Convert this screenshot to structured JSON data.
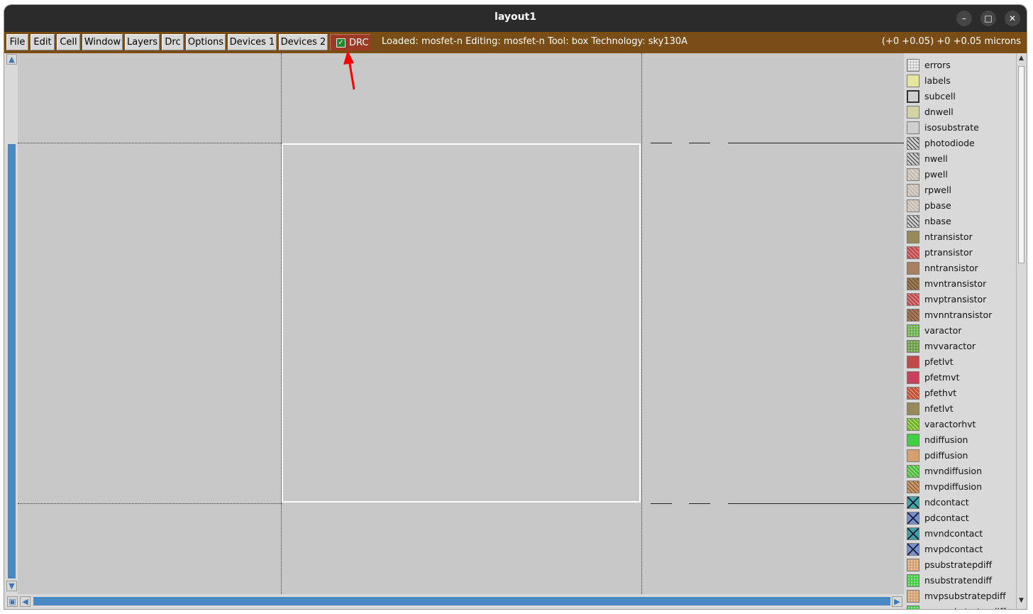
{
  "window": {
    "title": "layout1",
    "minimize_label": "–",
    "maximize_label": "□",
    "close_label": "✕"
  },
  "menu": {
    "items": [
      {
        "label": "File"
      },
      {
        "label": "Edit"
      },
      {
        "label": "Cell"
      },
      {
        "label": "Window"
      },
      {
        "label": "Layers"
      },
      {
        "label": "Drc"
      },
      {
        "label": "Options"
      },
      {
        "label": "Devices 1"
      },
      {
        "label": "Devices 2"
      }
    ],
    "drc_toggle": {
      "label": "DRC",
      "checked": true
    }
  },
  "status": {
    "text": "Loaded: mosfet-n Editing: mosfet-n Tool: box  Technology: sky130A",
    "coords": "(+0 +0.05) +0 +0.05 microns"
  },
  "layers": [
    {
      "name": "errors",
      "color": "#e8e8e8",
      "pattern": "grid"
    },
    {
      "name": "labels",
      "color": "#e6e6a0",
      "pattern": "solid"
    },
    {
      "name": "subcell",
      "color": "#d0d0d0",
      "pattern": "outline"
    },
    {
      "name": "dnwell",
      "color": "#d6d2a8",
      "pattern": "solid"
    },
    {
      "name": "isosubstrate",
      "color": "#cfcfcf",
      "pattern": "solid"
    },
    {
      "name": "photodiode",
      "color": "#d0d0d0",
      "pattern": "hatch"
    },
    {
      "name": "nwell",
      "color": "#d0d0d0",
      "pattern": "hatch"
    },
    {
      "name": "pwell",
      "color": "#d8cfc6",
      "pattern": "hatch-light"
    },
    {
      "name": "rpwell",
      "color": "#d8cfc6",
      "pattern": "hatch-light"
    },
    {
      "name": "pbase",
      "color": "#d8cfc6",
      "pattern": "hatch-light"
    },
    {
      "name": "nbase",
      "color": "#d0d0d0",
      "pattern": "hatch"
    },
    {
      "name": "ntransistor",
      "color": "#968a5a",
      "pattern": "solid"
    },
    {
      "name": "ptransistor",
      "color": "#c24a4a",
      "pattern": "hatch-red"
    },
    {
      "name": "nntransistor",
      "color": "#a88060",
      "pattern": "solid"
    },
    {
      "name": "mvntransistor",
      "color": "#9a7a50",
      "pattern": "hatch-dark"
    },
    {
      "name": "mvptransistor",
      "color": "#c24a4a",
      "pattern": "hatch-red"
    },
    {
      "name": "mvnntransistor",
      "color": "#a87858",
      "pattern": "hatch-dark"
    },
    {
      "name": "varactor",
      "color": "#6ab04a",
      "pattern": "dots"
    },
    {
      "name": "mvvaractor",
      "color": "#6a9a40",
      "pattern": "dots"
    },
    {
      "name": "pfetlvt",
      "color": "#c24a4a",
      "pattern": "solid"
    },
    {
      "name": "pfetmvt",
      "color": "#c8405a",
      "pattern": "solid"
    },
    {
      "name": "pfethvt",
      "color": "#c05030",
      "pattern": "hatch-red"
    },
    {
      "name": "nfetlvt",
      "color": "#968a5a",
      "pattern": "solid"
    },
    {
      "name": "varactorhvt",
      "color": "#70b030",
      "pattern": "hatch-green"
    },
    {
      "name": "ndiffusion",
      "color": "#44cc44",
      "pattern": "solid"
    },
    {
      "name": "pdiffusion",
      "color": "#d4a070",
      "pattern": "solid"
    },
    {
      "name": "mvndiffusion",
      "color": "#44bb44",
      "pattern": "hatch-green"
    },
    {
      "name": "mvpdiffusion",
      "color": "#d09868",
      "pattern": "hatch-dark"
    },
    {
      "name": "ndcontact",
      "color": "#40a8a0",
      "pattern": "cross"
    },
    {
      "name": "pdcontact",
      "color": "#7890c8",
      "pattern": "cross"
    },
    {
      "name": "mvndcontact",
      "color": "#40a0a0",
      "pattern": "cross"
    },
    {
      "name": "mvpdcontact",
      "color": "#7890c8",
      "pattern": "cross"
    },
    {
      "name": "psubstratepdiff",
      "color": "#d4a070",
      "pattern": "dots"
    },
    {
      "name": "nsubstratendiff",
      "color": "#44cc44",
      "pattern": "dots"
    },
    {
      "name": "mvpsubstratepdiff",
      "color": "#d4a070",
      "pattern": "dots"
    },
    {
      "name": "mvnsubstratendiff",
      "color": "#44cc44",
      "pattern": "dots"
    }
  ],
  "colors": {
    "titlebar": "#2b2b2b",
    "menubar": "#7a4d16",
    "drc_button": "#9d3a26",
    "canvas": "#c8c8c8",
    "scroll_trough": "#4a8ac4",
    "annotation_arrow": "#ff0000"
  }
}
